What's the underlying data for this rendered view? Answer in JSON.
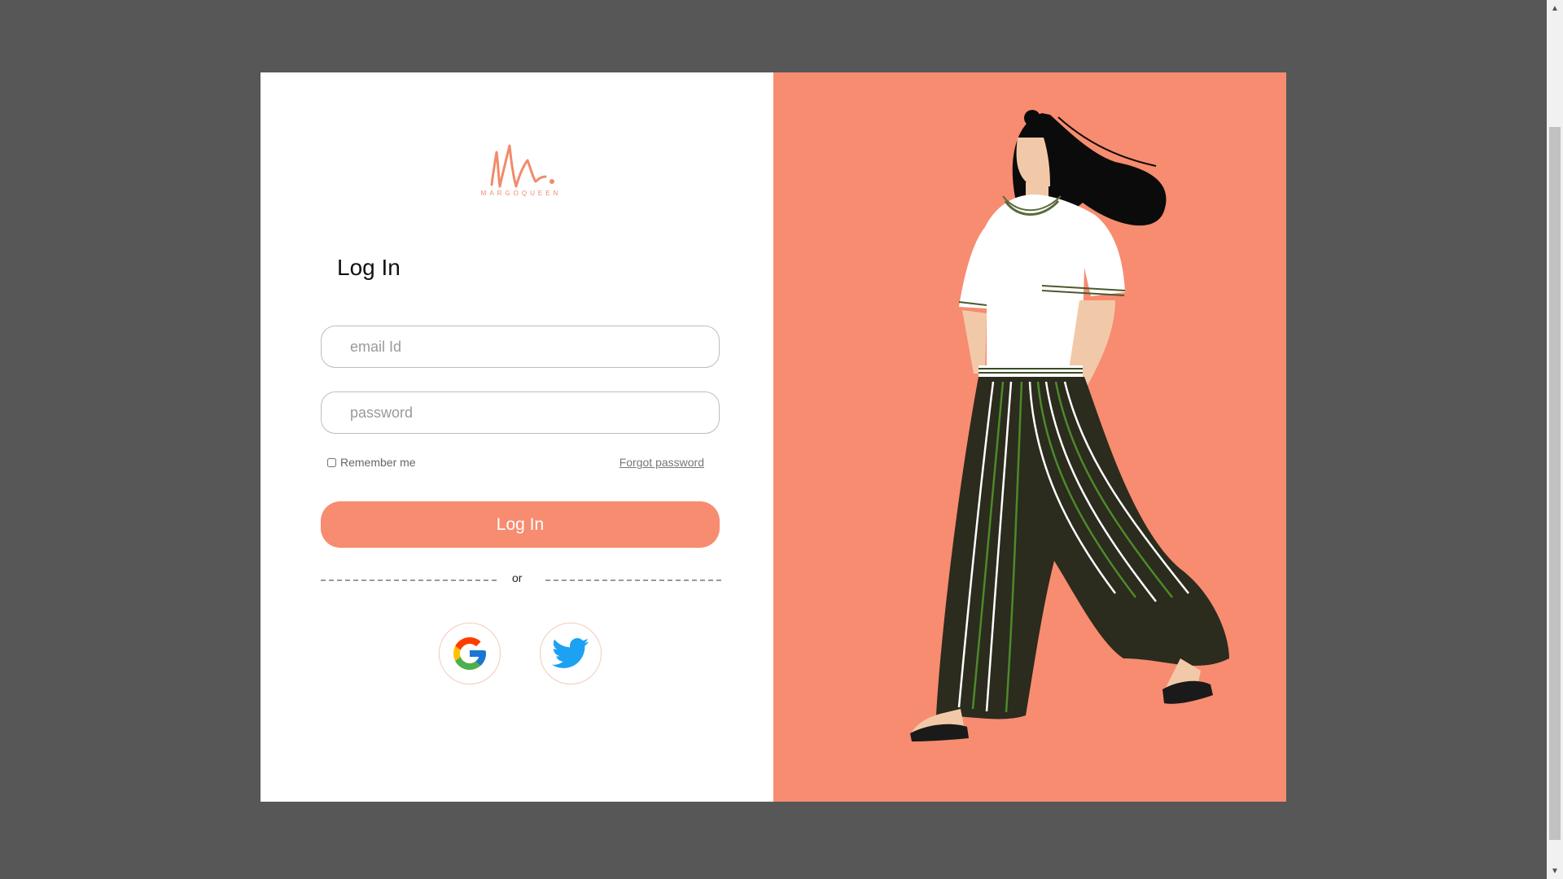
{
  "brand": {
    "logo_mark": "M.",
    "logo_subtitle": "MARGOQUEEN"
  },
  "login": {
    "title": "Log In",
    "email_placeholder": "email Id",
    "password_placeholder": "password",
    "remember_label": "Remember me",
    "remember_checked": false,
    "forgot_label": "Forgot password",
    "submit_label": "Log In",
    "divider_text": "or"
  },
  "social": {
    "google_icon": "google-icon",
    "twitter_icon": "twitter-icon"
  },
  "colors": {
    "accent": "#f78c70",
    "page_background": "#575757",
    "card_left": "#ffffff"
  }
}
